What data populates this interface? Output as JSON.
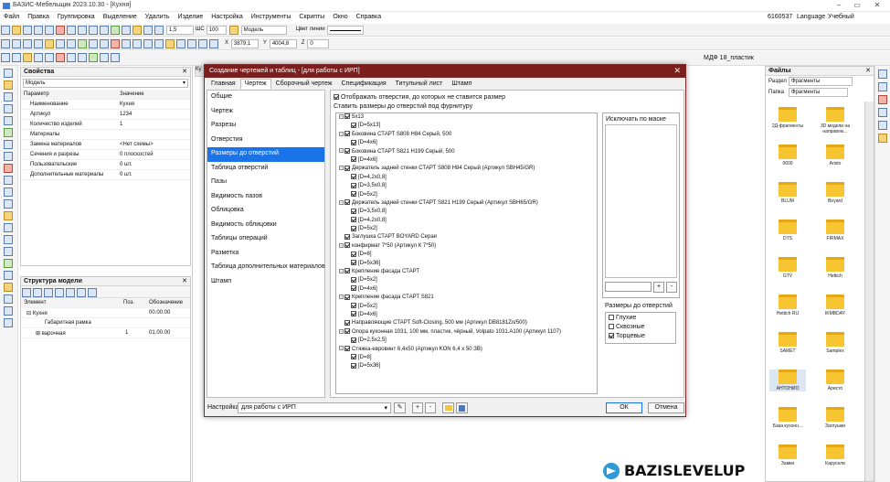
{
  "app": {
    "title": "БАЗИС-Мебельщик 2023.10.30 - [Кухня]"
  },
  "menu": [
    "Файл",
    "Правка",
    "Группировка",
    "Выделение",
    "Удалить",
    "Изделие",
    "Настройка",
    "Инструменты",
    "Скрипты",
    "Окно",
    "Справка"
  ],
  "menu_right": {
    "code": "6160537",
    "language": "Language",
    "mode": "Учебный"
  },
  "toolbar": {
    "line_width": "1,5",
    "step_label": "ШС",
    "step": "100",
    "layer": "Модель",
    "line_color_label": "Цвет линии"
  },
  "coords": {
    "x_label": "X",
    "x": "3879,1",
    "y_label": "Y",
    "y": "4004,8",
    "z_label": "Z",
    "z": "0"
  },
  "material_label": "МДФ 18_пластик",
  "properties": {
    "title": "Свойства",
    "selector": "Модель",
    "header": {
      "param": "Параметр",
      "value": "Значение"
    },
    "rows": [
      {
        "param": "Наименование",
        "value": "Кухня"
      },
      {
        "param": "Артикул",
        "value": "1234"
      },
      {
        "param": "Количество изделий",
        "value": "1"
      },
      {
        "param": "Материалы",
        "value": ""
      },
      {
        "param": "Замена материалов",
        "value": "<Нет схемы>"
      },
      {
        "param": "Сечения и разрезы",
        "value": "0 плоскостей"
      },
      {
        "param": "Пользовательские",
        "value": "0 шт."
      },
      {
        "param": "Дополнительные материалы",
        "value": "0 шт."
      }
    ]
  },
  "model_structure": {
    "title": "Структура модели",
    "cols": {
      "element": "Элемент",
      "pos": "Поз.",
      "designation": "Обозначение"
    },
    "rows": [
      {
        "element": "Кухня",
        "pos": "",
        "designation": "00.00.00"
      },
      {
        "element": "Габаритная рамка",
        "pos": "",
        "designation": ""
      },
      {
        "element": "варочная",
        "pos": "1",
        "designation": "01.00.00"
      }
    ]
  },
  "files": {
    "title": "Файлы",
    "section_label": "Раздел",
    "section_value": "Фрагменты",
    "folder_label": "Папка",
    "folder_value": "Фрагменты",
    "folders": [
      "2Д-фрагменты",
      "3D модели на направлю...",
      "0600",
      "Aristo",
      "BLUM",
      "Boyard",
      "DTS",
      "FIRMAX",
      "GTV",
      "Hettich",
      "Hettich RU",
      "IKMBDAY",
      "SAMET",
      "Samplex",
      "АНТОНИО",
      "Аристо",
      "База кухонн...",
      "Заглушки",
      "Замки",
      "Карусели"
    ]
  },
  "dialog": {
    "title": "Создание чертежей и таблиц - [для работы с ИРП]",
    "tabs": [
      "Главная",
      "Чертеж",
      "Сборочный чертеж",
      "Спецификация",
      "Титульный лист",
      "Штамп"
    ],
    "active_tab": 1,
    "nav": [
      "Общие",
      "Чертеж",
      "Разрезы",
      "Отверстия",
      "Размеры до отверстий",
      "Таблица отверстий",
      "Пазы",
      "Видимость пазов",
      "Облицовка",
      "Видимость облицовки",
      "Таблицы операций",
      "Разметка",
      "Таблица дополнительных материалов",
      "Штамп"
    ],
    "nav_selected": 4,
    "show_holes_label": "Отображать отверстия, до которых не ставится размер",
    "set_dims_label": "Ставить размеры до отверстий под фурнитуру",
    "tree": [
      {
        "level": 0,
        "exp": true,
        "label": "5x13"
      },
      {
        "level": 1,
        "label": "[D=5x13]"
      },
      {
        "level": 0,
        "exp": true,
        "label": "Боковина СТАРТ S808 H84 Серый, 500"
      },
      {
        "level": 1,
        "label": "[D=4x6]"
      },
      {
        "level": 0,
        "exp": true,
        "label": "Боковина СТАРТ S821 H199 Серый, 500"
      },
      {
        "level": 1,
        "label": "[D=4x6]"
      },
      {
        "level": 0,
        "exp": true,
        "label": "Держатель задней стенки СТАРТ S808 H84 Серый (Артикул SBH45/GR)"
      },
      {
        "level": 1,
        "label": "[D=4,2x0,8]"
      },
      {
        "level": 1,
        "label": "[D=3,5x0,8]"
      },
      {
        "level": 1,
        "label": "[D=5x2]"
      },
      {
        "level": 0,
        "exp": true,
        "label": "Держатель задней стенки СТАРТ S821 H199 Серый (Артикул SBH65/GR)"
      },
      {
        "level": 1,
        "label": "[D=3,5x0,8]"
      },
      {
        "level": 1,
        "label": "[D=4,2x0,8]"
      },
      {
        "level": 1,
        "label": "[D=5x2]"
      },
      {
        "level": 0,
        "exp": false,
        "label": "Заглушка СТАРТ BOYARD Серая"
      },
      {
        "level": 0,
        "exp": true,
        "label": "конфирмат 7*50 (Артикул К 7*50)"
      },
      {
        "level": 1,
        "label": "[D=8]"
      },
      {
        "level": 1,
        "label": "[D=5x36]"
      },
      {
        "level": 0,
        "exp": true,
        "label": "Крепление фасада СТАРТ"
      },
      {
        "level": 1,
        "label": "[D=5x2]"
      },
      {
        "level": 1,
        "label": "[D=4x6]"
      },
      {
        "level": 0,
        "exp": true,
        "label": "Крепление фасада СТАРТ S821"
      },
      {
        "level": 1,
        "label": "[D=5x2]"
      },
      {
        "level": 1,
        "label": "[D=4x6]"
      },
      {
        "level": 0,
        "exp": false,
        "label": "Направляющие СТАРТ Soft-Closing, 500 мм (Артикул DB8181Zn/500)"
      },
      {
        "level": 0,
        "exp": true,
        "label": "Опора кухонная 1031, 100 мм, пластик, чёрный, Volpato 1031.A100 (Артикул 1107)"
      },
      {
        "level": 1,
        "label": "[D=2,5x2,5]"
      },
      {
        "level": 0,
        "exp": true,
        "label": "Стяжка-евровинт 6,4x50 (Артикул KON 6,4 x 50 ЗВ)"
      },
      {
        "level": 1,
        "label": "[D=8]"
      },
      {
        "level": 1,
        "label": "[D=5x36]"
      }
    ],
    "exclude_label": "Исключать по маске",
    "plus": "+",
    "minus": "-",
    "dim_group_label": "Размеры до отверстий",
    "dim_options": [
      {
        "label": "Глухие",
        "checked": false
      },
      {
        "label": "Сквозные",
        "checked": false
      },
      {
        "label": "Торцевые",
        "checked": true
      }
    ],
    "footer": {
      "settings_label": "Настройка",
      "settings_value": "для работы с ИРП",
      "ok": "ОК",
      "cancel": "Отмена"
    }
  },
  "watermark": "BAZISLEVELUP"
}
